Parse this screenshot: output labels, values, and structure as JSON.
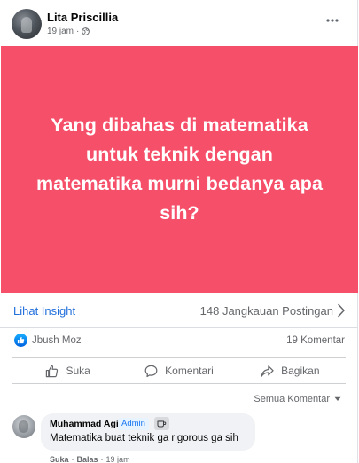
{
  "post": {
    "author": "Lita Priscillia",
    "time": "19 jam",
    "separator": "·",
    "text": "Yang dibahas di matematika untuk teknik dengan matematika murni bedanya apa sih?",
    "banner_color": "#f64f6a"
  },
  "insight": {
    "link": "Lihat Insight",
    "reach": "148 Jangkauan Postingan"
  },
  "stats": {
    "reactor": "Jbush Moz",
    "comments": "19 Komentar"
  },
  "actions": {
    "like": "Suka",
    "comment": "Komentari",
    "share": "Bagikan"
  },
  "comments_sort": "Semua Komentar",
  "comment": {
    "name": "Muhammad Agil",
    "badge": "Admin",
    "text": "Matematika buat teknik ga rigorous ga sih",
    "like": "Suka",
    "dot": "·",
    "reply": "Balas",
    "dot2": "·",
    "time": "19 jam"
  },
  "colors": {
    "link": "#216fdb",
    "secondary_text": "#65676b",
    "like_blue": "#1877f2"
  }
}
